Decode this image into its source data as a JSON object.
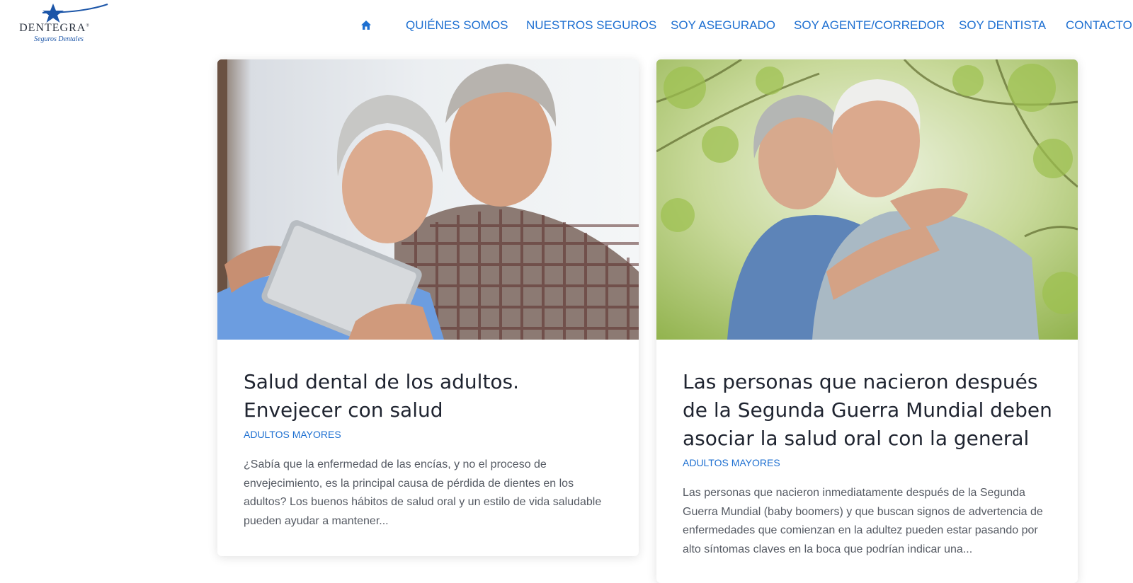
{
  "brand": {
    "name": "DENTEGRA",
    "registered": "®",
    "tagline": "Seguros Dentales"
  },
  "nav": {
    "home_icon": "home-icon",
    "items": [
      {
        "label": "QUIÉNES SOMOS"
      },
      {
        "label": "NUESTROS SEGUROS"
      },
      {
        "label": "SOY ASEGURADO"
      },
      {
        "label": "SOY AGENTE/CORREDOR"
      },
      {
        "label": "SOY DENTISTA"
      },
      {
        "label": "CONTACTO"
      }
    ]
  },
  "posts": [
    {
      "title": "Salud dental de los adultos. Envejecer con salud",
      "category": "ADULTOS MAYORES",
      "excerpt": "¿Sabía que la enfermedad de las encías, y no el proceso de envejecimiento, es la principal causa de pérdida de dientes en los adultos? Los buenos hábitos de salud oral y un estilo de vida saludable pueden ayudar a mantener..."
    },
    {
      "title": "Las personas que nacieron después de la Segunda Guerra Mundial deben asociar la salud oral con la general",
      "category": "ADULTOS MAYORES",
      "excerpt": "Las personas que nacieron inmediatamente después de la Segunda Guerra Mundial (baby boomers) y que buscan signos de advertencia de enfermedades que comienzan en la adultez pueden estar pasando por alto síntomas claves en la boca que podrían indicar una..."
    }
  ],
  "colors": {
    "accent": "#1d6fd1",
    "title": "#1f2430",
    "body_text": "#555a63",
    "logo_blue": "#1b55a8"
  }
}
